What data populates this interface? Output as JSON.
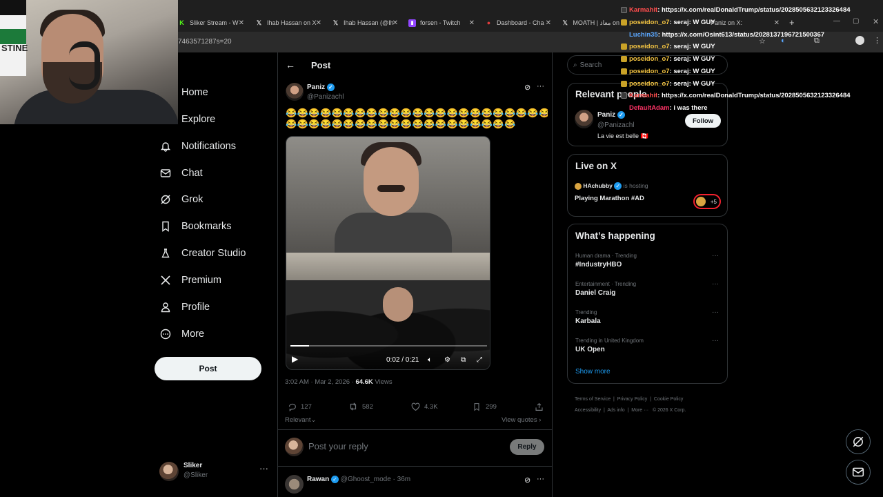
{
  "browser": {
    "tabs": [
      {
        "label": "Sliker Stream - W",
        "icon": "kick-icon"
      },
      {
        "label": "Ihab Hassan on X",
        "icon": "x-icon"
      },
      {
        "label": "Ihab Hassan (@Ih",
        "icon": "x-icon"
      },
      {
        "label": "forsen - Twitch",
        "icon": "twitch-icon"
      },
      {
        "label": "Dashboard - Cha",
        "icon": "dashboard-icon"
      },
      {
        "label": "MOATH | معاذ on",
        "icon": "x-icon"
      },
      {
        "label": "Paniz on X:",
        "icon": "x-icon"
      }
    ],
    "address": "7463571287s=20"
  },
  "nav": {
    "items": [
      {
        "label": "Home",
        "icon": "home-icon"
      },
      {
        "label": "Explore",
        "icon": "search-icon"
      },
      {
        "label": "Notifications",
        "icon": "bell-icon"
      },
      {
        "label": "Chat",
        "icon": "mail-icon"
      },
      {
        "label": "Grok",
        "icon": "grok-icon"
      },
      {
        "label": "Bookmarks",
        "icon": "bookmark-icon"
      },
      {
        "label": "Creator Studio",
        "icon": "creator-icon"
      },
      {
        "label": "Premium",
        "icon": "x-icon"
      },
      {
        "label": "Profile",
        "icon": "person-icon"
      },
      {
        "label": "More",
        "icon": "more-circle-icon"
      }
    ],
    "post_button": "Post",
    "account": {
      "name": "Sliker",
      "handle": "@Sliker"
    }
  },
  "post": {
    "header": "Post",
    "author_name": "Paniz",
    "author_handle": "@Panizachl",
    "emoji_line1": "😂😂😂😂😂😂😂😂😂😂😂😂😂😂😂😂😂😂😂😂😂😂😂😂",
    "emoji_line2": "😂😂😂😂😂😂😂😂😂😂😂😂😂😂😂😂😂😂😂😂",
    "video_time": "0:02 / 0:21",
    "video_progress": 0.095,
    "timestamp": "3:02 AM · Mar 2, 2026 · ",
    "views_count": "64.6K",
    "views_label": " Views",
    "replies": "127",
    "reposts": "582",
    "likes": "4.3K",
    "bookmarks": "299",
    "sort_label": "Relevant",
    "view_quotes": "View quotes",
    "reply_placeholder": "Post your reply",
    "reply_button": "Reply",
    "next_reply": {
      "name": "Rawan",
      "handle": "@Ghoost_mode",
      "time": "· 36m"
    }
  },
  "sidebar": {
    "search_placeholder": "Search",
    "relevant_title": "Relevant people",
    "relevant": {
      "name": "Paniz",
      "handle": "@Panizachl",
      "bio": "La vie est belle 🇨🇦",
      "follow": "Follow"
    },
    "live_title": "Live on X",
    "live": {
      "host": "HAchubby",
      "status": "is hosting",
      "title": "Playing Marathon #AD",
      "extra": "+5"
    },
    "happening_title": "What’s happening",
    "trends": [
      {
        "category": "Human drama · Trending",
        "name": "#IndustryHBO"
      },
      {
        "category": "Entertainment · Trending",
        "name": "Daniel Craig"
      },
      {
        "category": "Trending",
        "name": "Karbala"
      },
      {
        "category": "Trending in United Kingdom",
        "name": "UK Open"
      }
    ],
    "show_more": "Show more",
    "footer": [
      "Terms of Service",
      "Privacy Policy",
      "Cookie Policy",
      "Accessibility",
      "Ads info",
      "More ···",
      "© 2026 X Corp."
    ]
  },
  "chat": [
    {
      "user": "Karmahit",
      "color": "#ff4d4d",
      "text": ": https://x.com/realDonaldTrump/status/2028505632123326484",
      "badge": "mod"
    },
    {
      "user": "poseidon_o7",
      "color": "#f5c542",
      "text": ": seraj: W GUY",
      "badge": "gold"
    },
    {
      "user": "Luchin35",
      "color": "#5aa7ff",
      "text": ": https://x.com/Osint613/status/2028137196721500367",
      "badge": "none"
    },
    {
      "user": "poseidon_o7",
      "color": "#f5c542",
      "text": ": seraj: W GUY",
      "badge": "gold"
    },
    {
      "user": "poseidon_o7",
      "color": "#f5c542",
      "text": ": seraj: W GUY",
      "badge": "gold"
    },
    {
      "user": "poseidon_o7",
      "color": "#f5c542",
      "text": ": seraj: W GUY",
      "badge": "gold"
    },
    {
      "user": "poseidon_o7",
      "color": "#f5c542",
      "text": ": seraj: W GUY",
      "badge": "gold"
    },
    {
      "user": "Karmahit",
      "color": "#ff4d4d",
      "text": ": https://x.com/realDonaldTrump/status/2028505632123326484",
      "badge": "mod"
    },
    {
      "user": "DefaultAdam",
      "color": "#ff3366",
      "text": ": i was there",
      "badge": "none"
    }
  ],
  "colors": {
    "accent": "#1d9bf0",
    "text": "#e7e9ea",
    "muted": "#71767b",
    "border": "#2f3336"
  }
}
